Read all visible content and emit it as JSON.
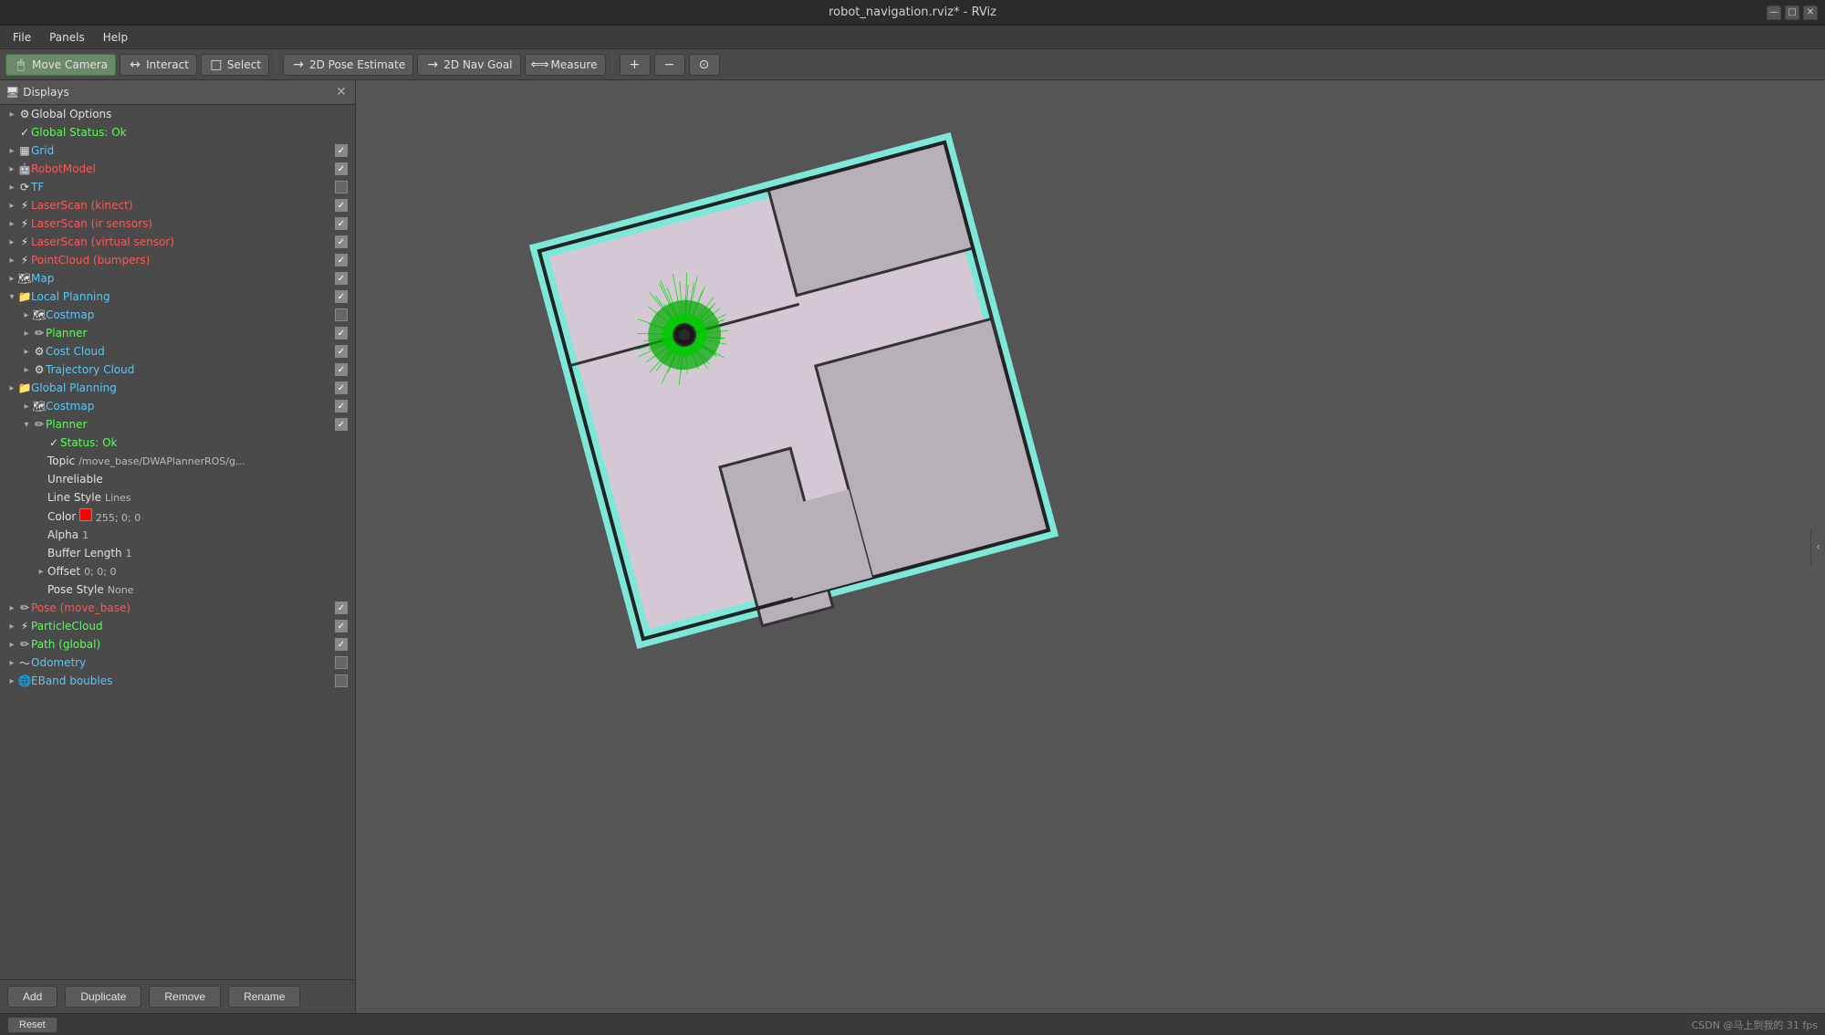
{
  "title_bar": {
    "title": "robot_navigation.rviz* - RViz",
    "btn_minimize": "—",
    "btn_maximize": "□",
    "btn_close": "✕"
  },
  "menu": {
    "items": [
      "File",
      "Panels",
      "Help"
    ]
  },
  "toolbar": {
    "move_camera_label": "Move Camera",
    "interact_label": "Interact",
    "select_label": "Select",
    "pose_estimate_label": "2D Pose Estimate",
    "nav_goal_label": "2D Nav Goal",
    "measure_label": "Measure"
  },
  "displays": {
    "header": "Displays",
    "tree": [
      {
        "id": "global_options",
        "indent": 0,
        "arrow": "collapsed",
        "icon": "⚙",
        "name": "Global Options",
        "color": "normal",
        "checked": null
      },
      {
        "id": "global_status",
        "indent": 0,
        "arrow": "leaf",
        "icon": "✓",
        "name": "Global Status: Ok",
        "color": "green",
        "checked": null
      },
      {
        "id": "grid",
        "indent": 0,
        "arrow": "collapsed",
        "icon": "▦",
        "name": "Grid",
        "color": "blue",
        "checked": true
      },
      {
        "id": "robot_model",
        "indent": 0,
        "arrow": "collapsed",
        "icon": "🤖",
        "name": "RobotModel",
        "color": "red",
        "checked": true
      },
      {
        "id": "tf",
        "indent": 0,
        "arrow": "collapsed",
        "icon": "⟳",
        "name": "TF",
        "color": "blue",
        "checked": false
      },
      {
        "id": "laserscan_kinect",
        "indent": 0,
        "arrow": "collapsed",
        "icon": "⚡",
        "name": "LaserScan (kinect)",
        "color": "red",
        "checked": true
      },
      {
        "id": "laserscan_ir",
        "indent": 0,
        "arrow": "collapsed",
        "icon": "⚡",
        "name": "LaserScan (ir sensors)",
        "color": "red",
        "checked": true
      },
      {
        "id": "laserscan_virtual",
        "indent": 0,
        "arrow": "collapsed",
        "icon": "⚡",
        "name": "LaserScan (virtual sensor)",
        "color": "red",
        "checked": true
      },
      {
        "id": "pointcloud_bumpers",
        "indent": 0,
        "arrow": "collapsed",
        "icon": "⚡",
        "name": "PointCloud (bumpers)",
        "color": "red",
        "checked": true
      },
      {
        "id": "map",
        "indent": 0,
        "arrow": "collapsed",
        "icon": "🗺",
        "name": "Map",
        "color": "blue",
        "checked": true
      },
      {
        "id": "local_planning",
        "indent": 0,
        "arrow": "expanded",
        "icon": "📁",
        "name": "Local Planning",
        "color": "blue",
        "checked": true
      },
      {
        "id": "costmap",
        "indent": 1,
        "arrow": "collapsed",
        "icon": "🗺",
        "name": "Costmap",
        "color": "blue",
        "checked": false
      },
      {
        "id": "planner",
        "indent": 1,
        "arrow": "collapsed",
        "icon": "✏",
        "name": "Planner",
        "color": "green",
        "checked": true
      },
      {
        "id": "cost_cloud",
        "indent": 1,
        "arrow": "collapsed",
        "icon": "⚙",
        "name": "Cost Cloud",
        "color": "blue",
        "checked": true
      },
      {
        "id": "trajectory_cloud",
        "indent": 1,
        "arrow": "collapsed",
        "icon": "⚙",
        "name": "Trajectory Cloud",
        "color": "blue",
        "checked": true
      },
      {
        "id": "global_planning",
        "indent": 0,
        "arrow": "collapsed",
        "icon": "📁",
        "name": "Global Planning",
        "color": "blue",
        "checked": true
      },
      {
        "id": "global_costmap",
        "indent": 1,
        "arrow": "collapsed",
        "icon": "🗺",
        "name": "Costmap",
        "color": "blue",
        "checked": true
      },
      {
        "id": "global_planner",
        "indent": 1,
        "arrow": "expanded",
        "icon": "✏",
        "name": "Planner",
        "color": "green",
        "checked": true
      },
      {
        "id": "status_ok",
        "indent": 2,
        "arrow": "leaf",
        "icon": "✓",
        "name": "Status: Ok",
        "color": "green",
        "checked": null
      },
      {
        "id": "topic",
        "indent": 2,
        "arrow": "leaf",
        "icon": "",
        "name": "Topic",
        "color": "normal",
        "value": "/move_base/DWAPlannerROS/g...",
        "checked": null
      },
      {
        "id": "unreliable",
        "indent": 2,
        "arrow": "leaf",
        "icon": "",
        "name": "Unreliable",
        "color": "normal",
        "value": "",
        "checked": null
      },
      {
        "id": "line_style",
        "indent": 2,
        "arrow": "leaf",
        "icon": "",
        "name": "Line Style",
        "color": "normal",
        "value": "Lines",
        "checked": null
      },
      {
        "id": "color_prop",
        "indent": 2,
        "arrow": "leaf",
        "icon": "",
        "name": "Color",
        "color": "normal",
        "value": "255; 0; 0",
        "swatch": "#ff0000",
        "checked": null
      },
      {
        "id": "alpha",
        "indent": 2,
        "arrow": "leaf",
        "icon": "",
        "name": "Alpha",
        "color": "normal",
        "value": "1",
        "checked": null
      },
      {
        "id": "buffer_length",
        "indent": 2,
        "arrow": "leaf",
        "icon": "",
        "name": "Buffer Length",
        "color": "normal",
        "value": "1",
        "checked": null
      },
      {
        "id": "offset",
        "indent": 2,
        "arrow": "collapsed",
        "icon": "",
        "name": "Offset",
        "color": "normal",
        "value": "0; 0; 0",
        "checked": null
      },
      {
        "id": "pose_style",
        "indent": 2,
        "arrow": "leaf",
        "icon": "",
        "name": "Pose Style",
        "color": "normal",
        "value": "None",
        "checked": null
      },
      {
        "id": "pose_move_base",
        "indent": 0,
        "arrow": "collapsed",
        "icon": "✏",
        "name": "Pose (move_base)",
        "color": "red",
        "checked": true
      },
      {
        "id": "particle_cloud",
        "indent": 0,
        "arrow": "collapsed",
        "icon": "⚡",
        "name": "ParticleCloud",
        "color": "green",
        "checked": true
      },
      {
        "id": "path_global",
        "indent": 0,
        "arrow": "collapsed",
        "icon": "✏",
        "name": "Path (global)",
        "color": "green",
        "checked": true
      },
      {
        "id": "odometry",
        "indent": 0,
        "arrow": "collapsed",
        "icon": "〜",
        "name": "Odometry",
        "color": "blue",
        "checked": false
      },
      {
        "id": "eband",
        "indent": 0,
        "arrow": "collapsed",
        "icon": "🌐",
        "name": "EBand boubles",
        "color": "blue",
        "checked": false
      }
    ]
  },
  "buttons": {
    "add": "Add",
    "duplicate": "Duplicate",
    "remove": "Remove",
    "rename": "Rename"
  },
  "status_bar": {
    "reset": "Reset",
    "right_info": "CSDN @马上到我的 31 fps"
  }
}
